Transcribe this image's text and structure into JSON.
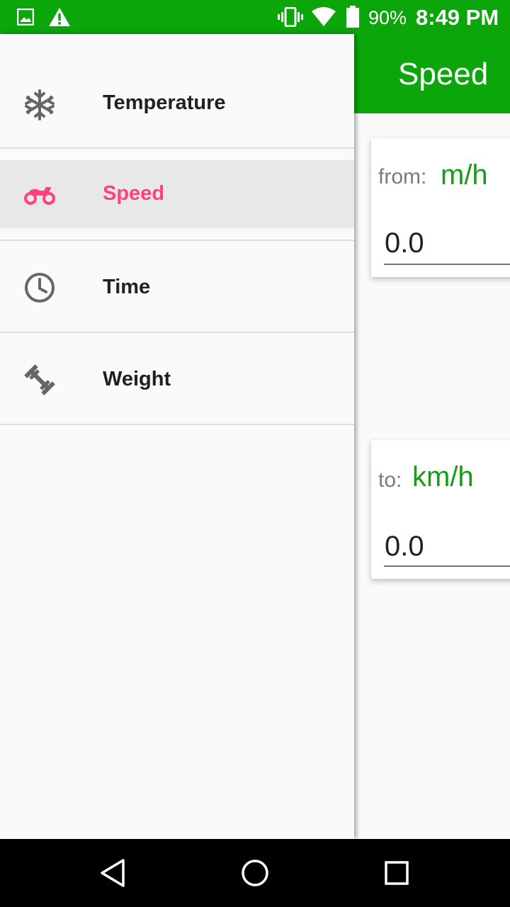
{
  "status_bar": {
    "battery_percent": "90%",
    "time": "8:49 PM",
    "icons": [
      "image-icon",
      "warning-icon",
      "vibrate-icon",
      "wifi-icon",
      "battery-icon"
    ]
  },
  "app_bar": {
    "title": "Speed"
  },
  "converter": {
    "from": {
      "label": "from:",
      "unit": "m/h",
      "value": "0.0"
    },
    "to": {
      "label": "to:",
      "unit": "km/h",
      "value": "0.0"
    }
  },
  "drawer": {
    "items": [
      {
        "label": "Temperature",
        "icon": "snowflake-icon",
        "selected": false
      },
      {
        "label": "Speed",
        "icon": "motorcycle-icon",
        "selected": true
      },
      {
        "label": "Time",
        "icon": "clock-icon",
        "selected": false
      },
      {
        "label": "Weight",
        "icon": "dumbbell-icon",
        "selected": false
      }
    ]
  },
  "colors": {
    "primary": "#0aa60a",
    "accent": "#ff4081",
    "unit_text": "#12a012"
  }
}
